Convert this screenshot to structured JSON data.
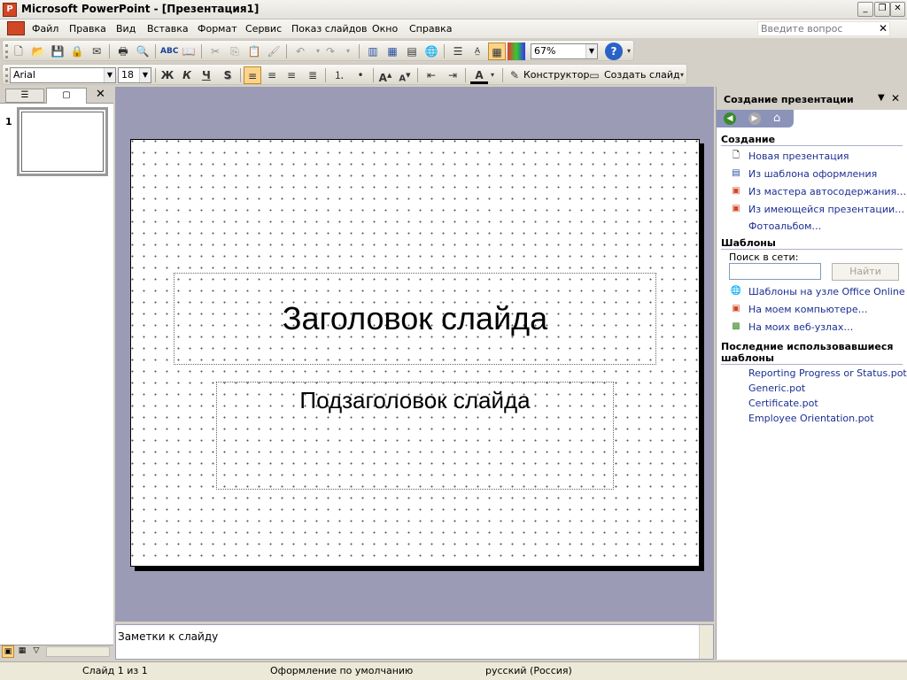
{
  "window": {
    "title": "Microsoft PowerPoint - [Презентация1]",
    "controls": [
      "minimize-icon",
      "restore-icon",
      "close-icon"
    ]
  },
  "menu": {
    "items": [
      "Файл",
      "Правка",
      "Вид",
      "Вставка",
      "Формат",
      "Сервис",
      "Показ слайдов",
      "Окно",
      "Справка"
    ],
    "ask_placeholder": "Введите вопрос"
  },
  "standard_toolbar": {
    "zoom": "67%"
  },
  "formatting_toolbar": {
    "font": "Arial",
    "size": "18",
    "bold": "Ж",
    "italic": "К",
    "underline": "Ч",
    "shadow": "S",
    "designer": "Конструктор",
    "new_slide": "Создать слайд"
  },
  "left_panel": {
    "slide_number": "1"
  },
  "slide": {
    "title": "Заголовок слайда",
    "subtitle": "Подзаголовок слайда"
  },
  "notes": {
    "placeholder": "Заметки к слайду"
  },
  "task_pane": {
    "title": "Создание презентации",
    "sections": {
      "create": {
        "header": "Создание",
        "links": [
          "Новая презентация",
          "Из шаблона оформления",
          "Из мастера автосодержания…",
          "Из имеющейся презентации…",
          "Фотоальбом…"
        ]
      },
      "templates": {
        "header": "Шаблоны",
        "search_label": "Поиск в сети:",
        "search_value": "",
        "search_button": "Найти",
        "links": [
          "Шаблоны на узле Office Online",
          "На моем компьютере…",
          "На моих веб-узлах…"
        ]
      },
      "recent": {
        "header_line1": "Последние использовавшиеся",
        "header_line2": "шаблоны",
        "files": [
          "Reporting Progress or Status.pot",
          "Generic.pot",
          "Certificate.pot",
          "Employee Orientation.pot"
        ]
      }
    }
  },
  "status": {
    "slide": "Слайд 1 из 1",
    "design": "Оформление по умолчанию",
    "language": "русский (Россия)"
  },
  "colors": {
    "workspace": "#9b9bb5",
    "link": "#1b2f93"
  }
}
